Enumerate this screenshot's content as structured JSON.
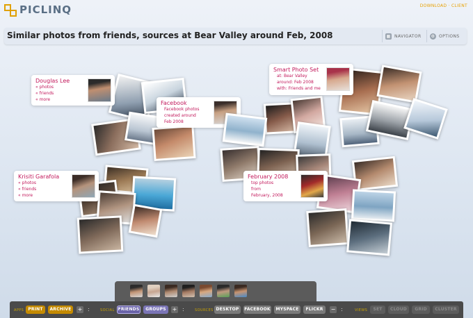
{
  "app": {
    "logo_text": "PICLINQ",
    "top_right_link": "DOWNLOAD · CLIENT"
  },
  "header": {
    "title": "Similar photos from friends, sources at Bear Valley around Feb, 2008",
    "navigator_label": "NAVIGATOR",
    "options_label": "OPTIONS"
  },
  "cards": {
    "douglas": {
      "title": "Douglas Lee",
      "lines": [
        "« photos",
        "« friends",
        "« more"
      ]
    },
    "facebook": {
      "title": "Facebook",
      "lines": [
        "Facebook photos",
        "created around",
        "Feb 2008"
      ]
    },
    "smart": {
      "title": "Smart Photo Set",
      "lines": [
        "at: Bear Valley",
        "around: Feb 2008",
        "with: Friends and me"
      ]
    },
    "krisiti": {
      "title": "Krisiti Garafola",
      "lines": [
        "« photos",
        "« friends",
        "« more"
      ]
    },
    "february": {
      "title": "February 2008",
      "lines": [
        "top photos",
        "from",
        "February, 2008"
      ]
    }
  },
  "bottombar": {
    "apps_label": "APPS",
    "print_label": "PRINT",
    "archive_label": "ARCHIVE",
    "social_label": "SOCIAL",
    "friends_label": "FRIENDS",
    "groups_label": "GROUPS",
    "sources_label": "SOURCES",
    "desktop_label": "DESKTOP",
    "facebook_label": "FACEBOOK",
    "myspace_label": "MYSPACE",
    "flickr_label": "FLICKR",
    "views_label": "VIEWS",
    "set_label": "SET",
    "cloud_label": "CLOUD",
    "grid_label": "GRID",
    "cluster_label": "CLUSTER",
    "plus": "+",
    "minus": "−",
    "colon": ":"
  },
  "colors": {
    "accent_gold": "#c48a00",
    "social_purple": "#7b75b6",
    "card_title": "#c2185b"
  }
}
